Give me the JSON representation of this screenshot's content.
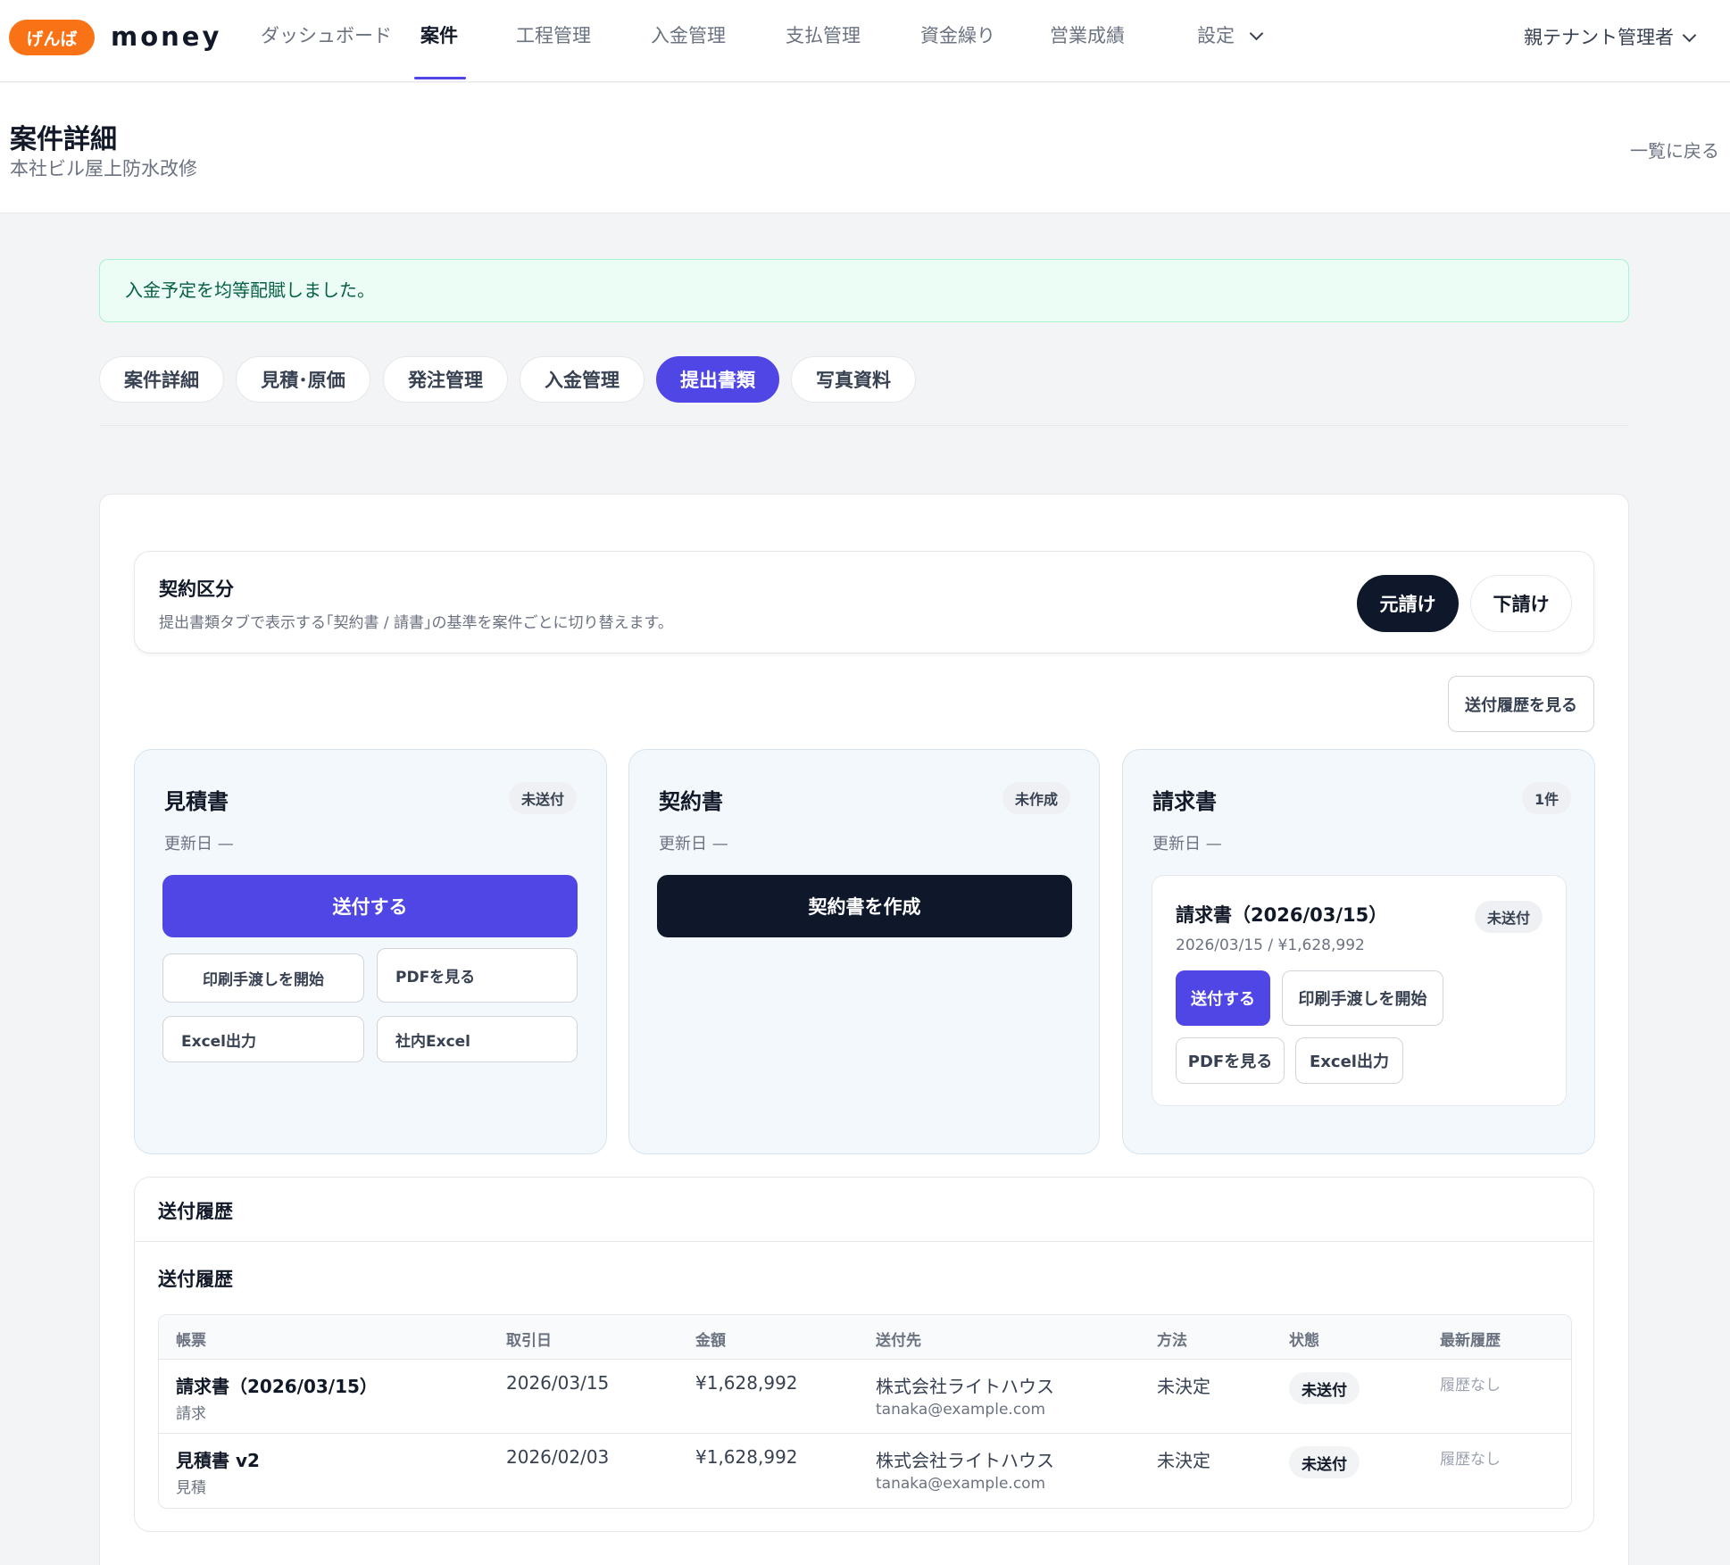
{
  "header": {
    "brand_badge": "げんば",
    "brand_name": "money",
    "nav": [
      {
        "label": "ダッシュボード"
      },
      {
        "label": "案件"
      },
      {
        "label": "工程管理"
      },
      {
        "label": "入金管理"
      },
      {
        "label": "支払管理"
      },
      {
        "label": "資金繰り"
      },
      {
        "label": "営業成績"
      },
      {
        "label": "設定"
      }
    ],
    "active_nav": "案件",
    "user_label": "親テナント管理者"
  },
  "page": {
    "title": "案件詳細",
    "subtitle": "本社ビル屋上防水改修",
    "back_label": "一覧に戻る"
  },
  "notice": {
    "text": "入金予定を均等配賦しました。"
  },
  "tabs": [
    {
      "label": "案件詳細"
    },
    {
      "label": "見積･原価"
    },
    {
      "label": "発注管理"
    },
    {
      "label": "入金管理"
    },
    {
      "label": "提出書類"
    },
    {
      "label": "写真資料"
    }
  ],
  "active_tab": "提出書類",
  "contract": {
    "title": "契約区分",
    "description": "提出書類タブで表示する｢契約書 / 請書｣の基準を案件ごとに切り替えます。",
    "options": [
      "元請け",
      "下請け"
    ],
    "selected": "元請け"
  },
  "history_button": "送付履歴を見る",
  "cards": {
    "estimate": {
      "title": "見積書",
      "badge": "未送付",
      "updated": "更新日 —",
      "primary": "送付する",
      "buttons": [
        "印刷手渡しを開始",
        "PDFを見る",
        "Excel出力",
        "社内Excel"
      ]
    },
    "contract": {
      "title": "契約書",
      "badge": "未作成",
      "updated": "更新日 —",
      "primary": "契約書を作成"
    },
    "invoice": {
      "title": "請求書",
      "badge": "1件",
      "updated": "更新日 —",
      "item": {
        "title": "請求書（2026/03/15）",
        "badge": "未送付",
        "meta": "2026/03/15 / ¥1,628,992",
        "buttons": [
          "送付する",
          "印刷手渡しを開始",
          "PDFを見る",
          "Excel出力"
        ]
      }
    }
  },
  "history": {
    "section_title": "送付履歴",
    "table_title": "送付履歴",
    "columns": [
      "帳票",
      "取引日",
      "金額",
      "送付先",
      "方法",
      "状態",
      "最新履歴"
    ],
    "rows": [
      {
        "doc": "請求書（2026/03/15）",
        "doc_type": "請求",
        "date": "2026/03/15",
        "amount": "¥1,628,992",
        "recipient": "株式会社ライトハウス",
        "email": "tanaka@example.com",
        "method": "未決定",
        "status": "未送付",
        "latest": "履歴なし"
      },
      {
        "doc": "見積書 v2",
        "doc_type": "見積",
        "date": "2026/02/03",
        "amount": "¥1,628,992",
        "recipient": "株式会社ライトハウス",
        "email": "tanaka@example.com",
        "method": "未決定",
        "status": "未送付",
        "latest": "履歴なし"
      }
    ]
  },
  "colors": {
    "brand": "#f97316",
    "accent": "#4f46e5",
    "dark": "#0f172a",
    "success_bg": "#ecfdf5"
  }
}
